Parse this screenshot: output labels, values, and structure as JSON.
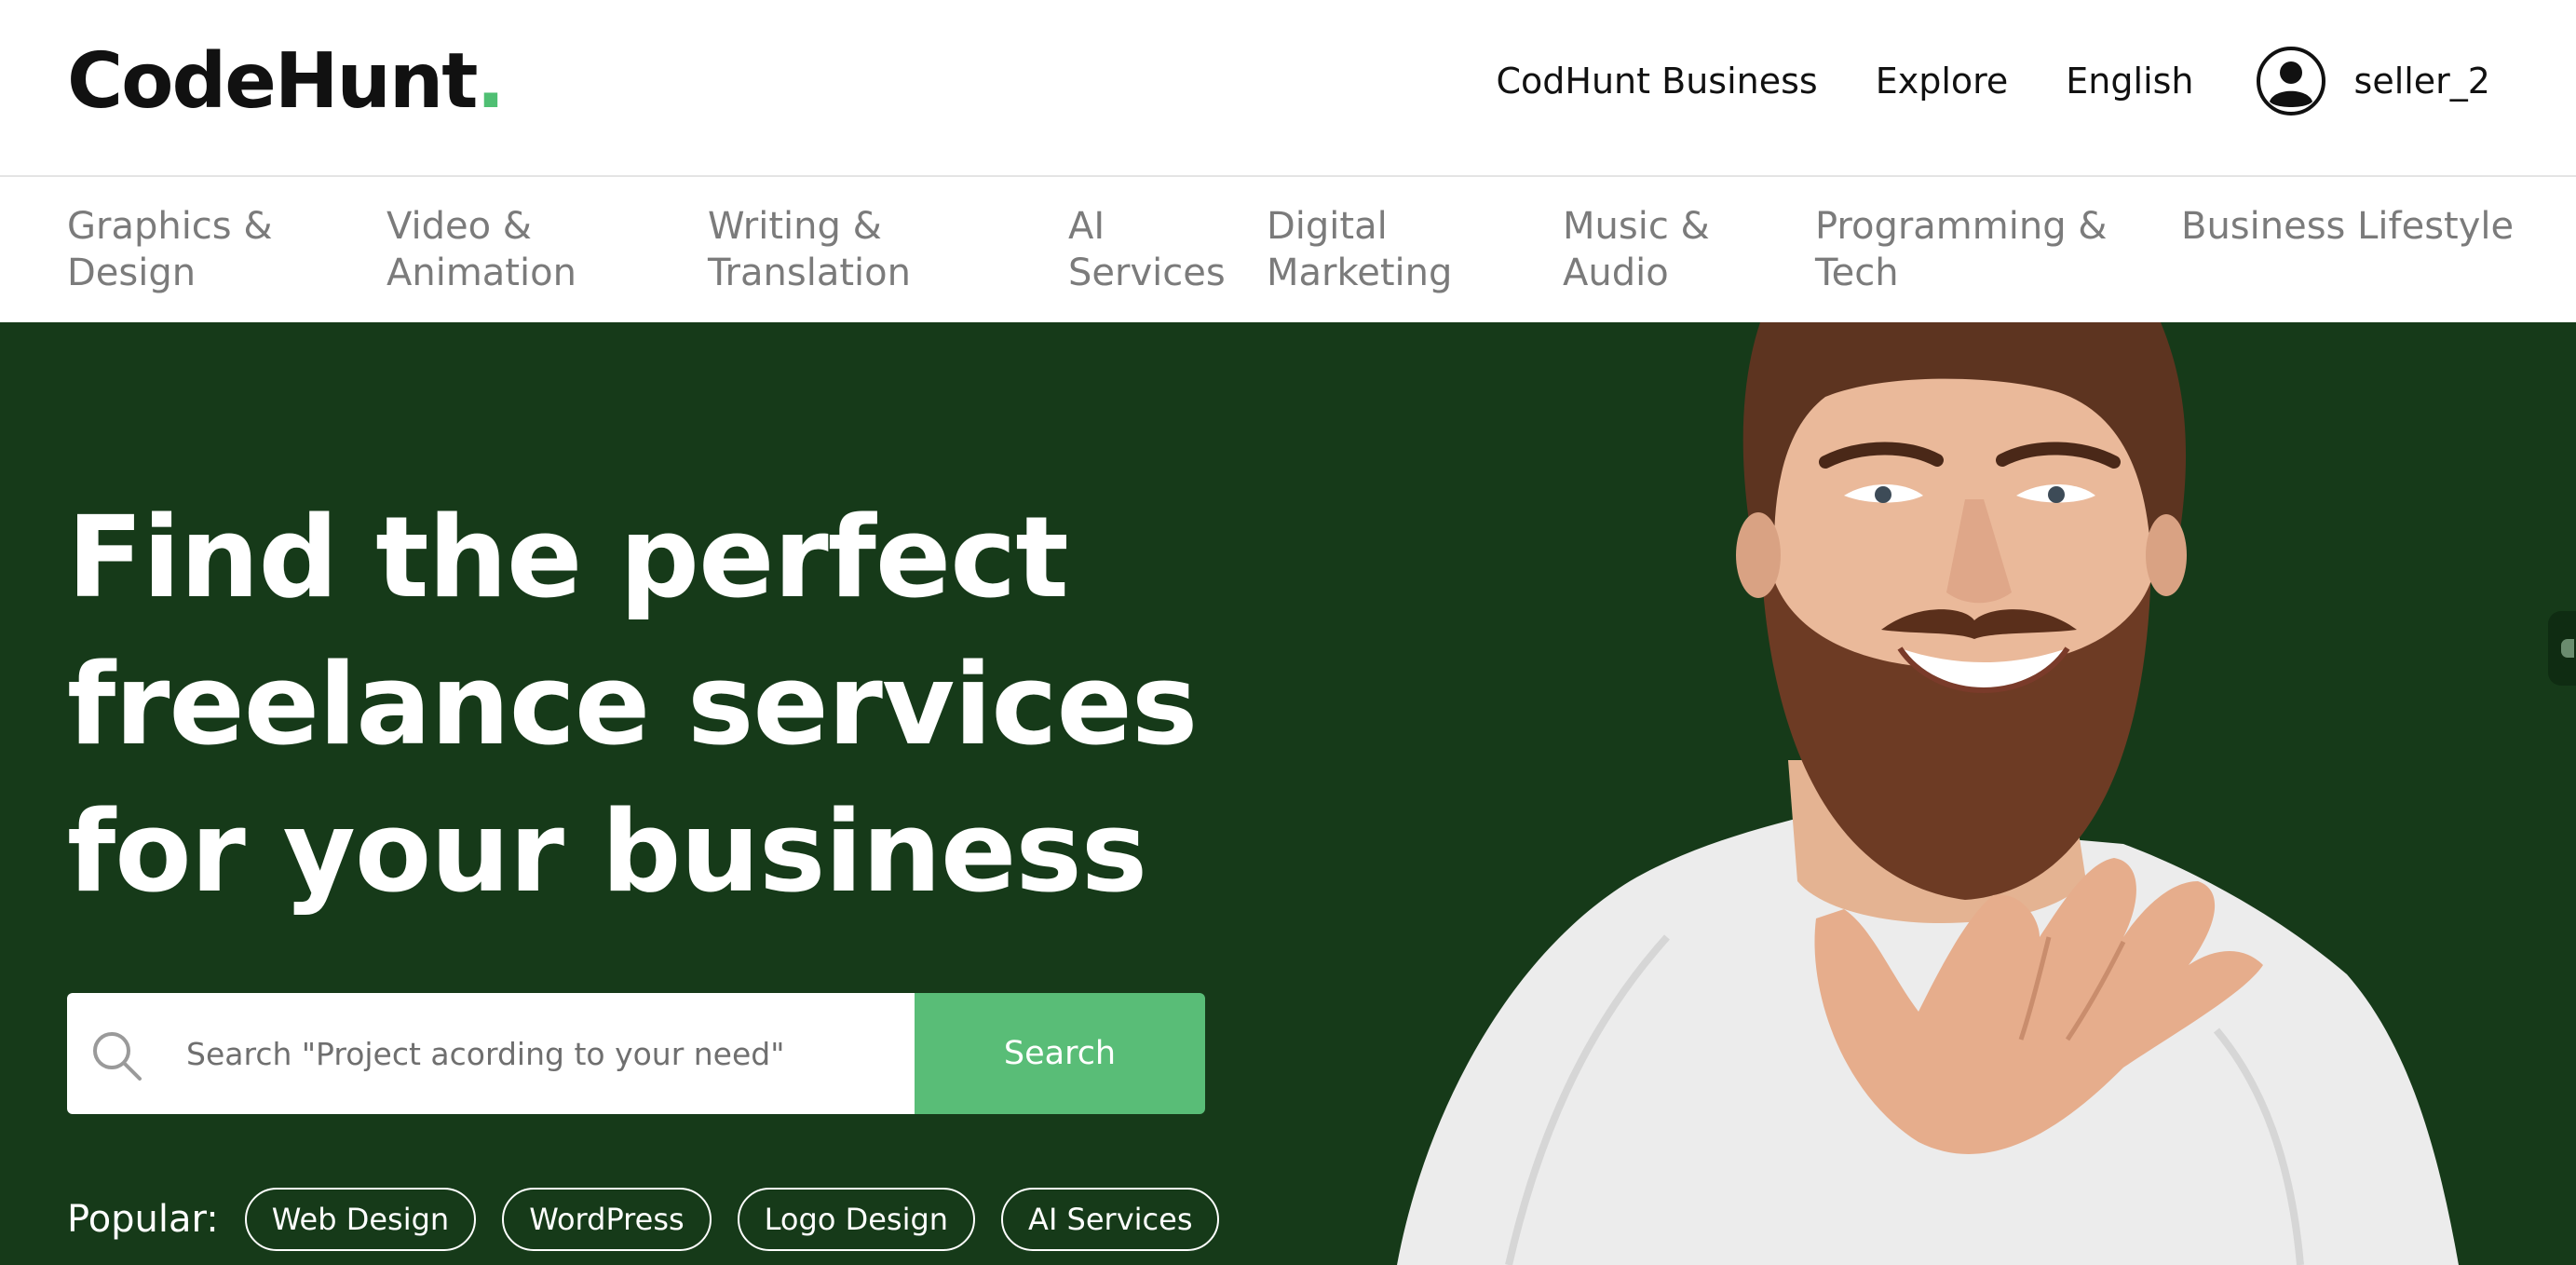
{
  "header": {
    "logo_text": "CodeHunt",
    "logo_dot": ".",
    "nav": {
      "business": "CodHunt Business",
      "explore": "Explore",
      "language": "English"
    },
    "user": {
      "name": "seller_2",
      "icon": "user-circle-icon"
    }
  },
  "categories": [
    {
      "line1": "Graphics &",
      "line2": "Design"
    },
    {
      "line1": "Video &",
      "line2": "Animation"
    },
    {
      "line1": "Writing &",
      "line2": "Translation"
    },
    {
      "line1": "AI",
      "line2": "Services"
    },
    {
      "line1": "Digital",
      "line2": "Marketing"
    },
    {
      "line1": "Music &",
      "line2": "Audio"
    },
    {
      "line1": "Programming &",
      "line2": "Tech"
    },
    {
      "line1": "Business Lifestyle",
      "line2": ""
    }
  ],
  "hero": {
    "title_lines": [
      "Find the perfect",
      "freelance services",
      "for your business"
    ],
    "search": {
      "placeholder": "Search \"Project acording to your need\"",
      "value": "",
      "button_label": "Search",
      "icon": "search-icon"
    },
    "popular": {
      "label": "Popular:",
      "tags": [
        "Web Design",
        "WordPress",
        "Logo Design",
        "AI Services"
      ]
    }
  },
  "colors": {
    "brand_green": "#59bd77",
    "logo_dot_green": "#4fbf73",
    "hero_background": "#163a19",
    "category_text": "#7b7b7b"
  }
}
